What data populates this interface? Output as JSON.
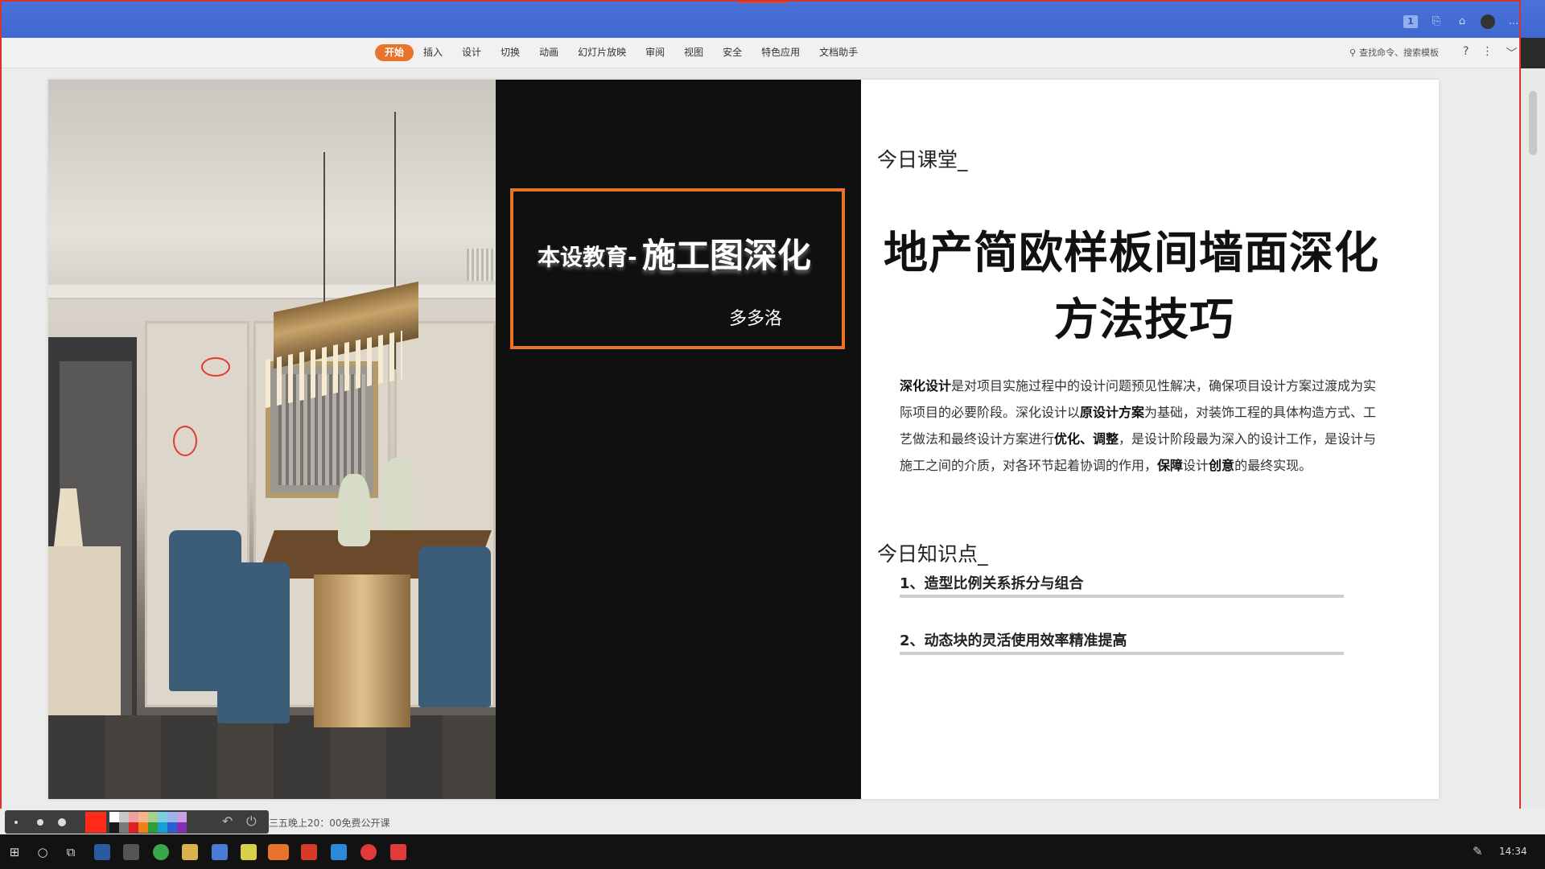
{
  "ribbon": {
    "tabs": [
      {
        "label": "开始",
        "active": true
      },
      {
        "label": "插入"
      },
      {
        "label": "设计"
      },
      {
        "label": "切换"
      },
      {
        "label": "动画"
      },
      {
        "label": "幻灯片放映"
      },
      {
        "label": "审阅"
      },
      {
        "label": "视图"
      },
      {
        "label": "安全"
      },
      {
        "label": "特色应用"
      },
      {
        "label": "文档助手"
      }
    ],
    "search_label": "查找命令、搜索模板",
    "help_glyph": "?",
    "more_glyph": "⋮",
    "collapse_glyph": "﹀"
  },
  "titlebar": {
    "slide_number_badge": "1"
  },
  "slide": {
    "brand_prefix": "本设教育-",
    "brand_main": "施工图深化",
    "author": "多多洛",
    "section1_heading": "今日课堂_",
    "title_line1": "地产简欧样板间墙面深化",
    "title_line2": "方法技巧",
    "paragraph": [
      {
        "text": "深化设计",
        "bold": true
      },
      {
        "text": "是对项目实施过程中的设计问题预见性解决，确保项目设计方案过渡成为实际项目的必要阶段。深化设计以",
        "bold": false
      },
      {
        "text": "原设计方案",
        "bold": true
      },
      {
        "text": "为基础，对装饰工程的具体构造方式、工艺做法和最终设计方案进行",
        "bold": false
      },
      {
        "text": "优化、调整",
        "bold": true
      },
      {
        "text": "，是设计阶段最为深入的设计工作，是设计与施工之间的介质，对各环节起着协调的作用，",
        "bold": false
      },
      {
        "text": "保障",
        "bold": true
      },
      {
        "text": "设计",
        "bold": false
      },
      {
        "text": "创意",
        "bold": true
      },
      {
        "text": "的最终实现。",
        "bold": false
      }
    ],
    "section2_heading": "今日知识点_",
    "knowledge_points": [
      "1、造型比例关系拆分与组合",
      "2、动态块的灵活使用效率精准提高"
    ]
  },
  "statusbar": {
    "text": "三五晚上20：00免费公开课",
    "current_pen_color": "#ff2a1a",
    "palette": [
      "#ffffff",
      "#c8c8c8",
      "#f0a0a0",
      "#f6b48a",
      "#a7d08f",
      "#7ccfe0",
      "#9ab3ea",
      "#c9a0e0",
      "#1a1a1a",
      "#7a7a7a",
      "#e02020",
      "#f0801a",
      "#2e9e3a",
      "#1aa0d0",
      "#2a60d0",
      "#8030b0"
    ],
    "undo_glyph": "↶",
    "power_glyph": "⏻"
  },
  "taskbar": {
    "clock": "14:34"
  },
  "colors": {
    "accent_orange": "#e8742b",
    "titlebar_blue": "#4a72d8",
    "dark_panel": "#0f100f",
    "annotation_red": "#e23a2f"
  }
}
